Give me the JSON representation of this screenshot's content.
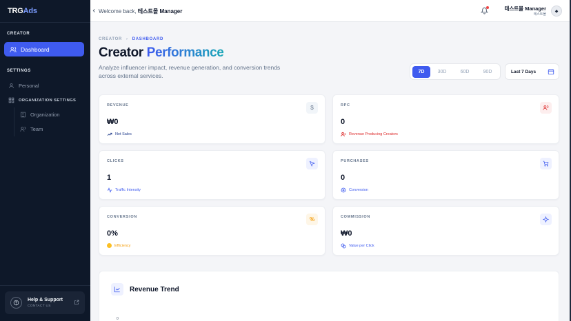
{
  "brand": {
    "name": "TRG",
    "suffix": "Ads"
  },
  "sidebar": {
    "section_creator": "CREATOR",
    "dashboard_label": "Dashboard",
    "section_settings": "SETTINGS",
    "personal_label": "Personal",
    "org_settings_label": "ORGANIZATION SETTINGS",
    "organization_label": "Organization",
    "team_label": "Team",
    "help_title": "Help & Support",
    "help_sub": "CONTACT US"
  },
  "topbar": {
    "welcome_prefix": "Welcome back,",
    "welcome_name": "테스트몰 Manager",
    "user_name": "테스트몰 Manager",
    "user_role": "테스트몰"
  },
  "breadcrumb": {
    "root": "CREATOR",
    "sep": "›",
    "current": "DASHBOARD"
  },
  "page": {
    "title_main": "Creator",
    "title_accent": "Performance",
    "subtitle": "Analyze influencer impact, revenue generation, and conversion trends across external services."
  },
  "range": {
    "options": [
      "7D",
      "30D",
      "60D",
      "90D"
    ],
    "selected": "7D",
    "date_label": "Last 7 Days"
  },
  "cards": [
    {
      "label": "REVENUE",
      "value": "₩0",
      "foot": "Net Sales",
      "icon": "dollar-icon",
      "foot_color": "#1e3a8a"
    },
    {
      "label": "RPC",
      "value": "0",
      "foot": "Revenue Producing Creators",
      "icon": "users-icon",
      "foot_color": "#dc2626"
    },
    {
      "label": "CLICKS",
      "value": "1",
      "foot": "Traffic Intensity",
      "icon": "cursor-icon",
      "foot_color": "#3f5bef"
    },
    {
      "label": "PURCHASES",
      "value": "0",
      "foot": "Conversion",
      "icon": "cart-icon",
      "foot_color": "#3f5bef"
    },
    {
      "label": "CONVERSION",
      "value": "0%",
      "foot": "Efficiency",
      "icon": "percent-icon",
      "foot_color": "#f59e0b"
    },
    {
      "label": "COMMISSION",
      "value": "₩0",
      "foot": "Value per Click",
      "icon": "sparkle-icon",
      "foot_color": "#3f5bef"
    }
  ],
  "trend": {
    "title": "Revenue Trend",
    "y_tick": "0"
  },
  "colors": {
    "accent": "#3f5bef",
    "sidebar_bg": "#0e1829",
    "danger": "#dc2626",
    "warning": "#f59e0b"
  }
}
